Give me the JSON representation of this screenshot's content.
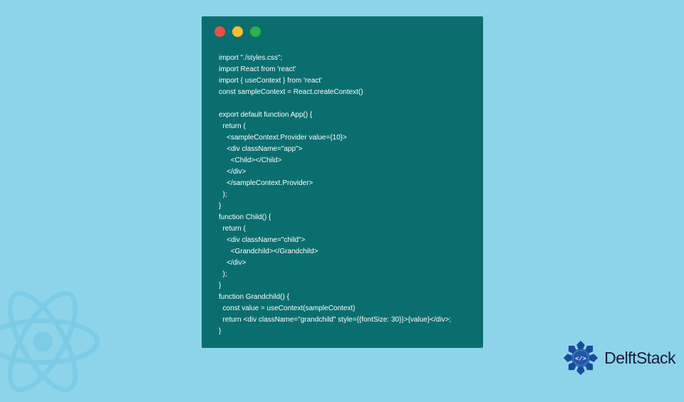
{
  "code": {
    "lines": [
      "import \"./styles.css\";",
      "import React from 'react'",
      "import { useContext } from 'react'",
      "const sampleContext = React.createContext()",
      "",
      "export default function App() {",
      "  return (",
      "    <sampleContext.Provider value={10}>",
      "    <div className=\"app\">",
      "      <Child></Child>",
      "    </div>",
      "    </sampleContext.Provider>",
      "  );",
      "}",
      "function Child() {",
      "  return (",
      "    <div className=\"child\">",
      "      <Grandchild></Grandchild>",
      "    </div>",
      "  );",
      "}",
      "function Grandchild() {",
      "  const value = useContext(sampleContext)",
      "  return <div className=\"grandchild\" style={{fontSize: 30}}>{value}</div>;",
      "}"
    ]
  },
  "branding": {
    "name": "DelftStack"
  },
  "window": {
    "dot_colors": [
      "#ec5044",
      "#f6c22e",
      "#2bb24c"
    ]
  }
}
